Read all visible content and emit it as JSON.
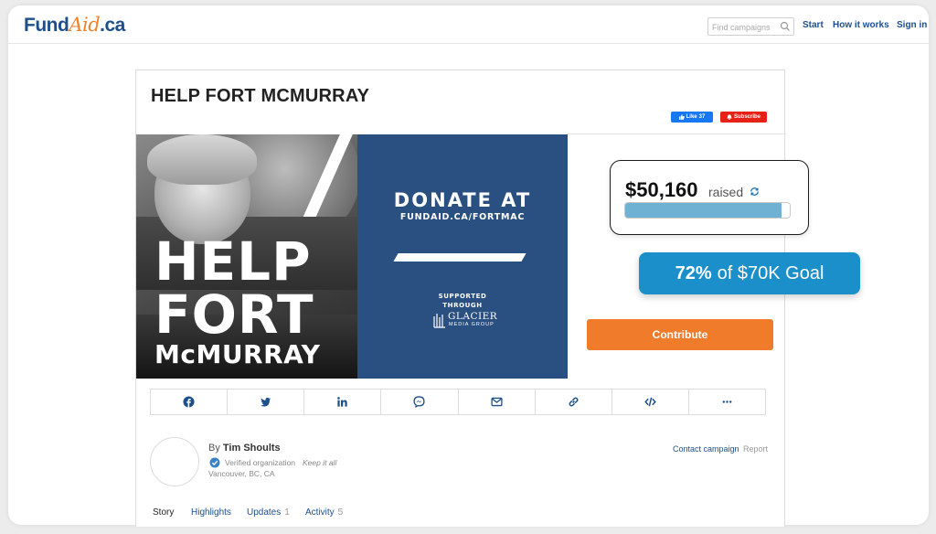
{
  "header": {
    "logo_part1": "Fund",
    "logo_part2": "Aid",
    "logo_part3": ".ca",
    "search_placeholder": "Find campaigns",
    "nav": [
      "Start",
      "How it works",
      "Sign in"
    ]
  },
  "campaign": {
    "title": "HELP FORT MCMURRAY",
    "fb_like_label": "Like",
    "fb_like_count": "37",
    "subscribe_label": "Subscribe",
    "hero": {
      "help": "HELP",
      "fort": "FORT",
      "mcmurray": "McMURRAY",
      "donate_at": "DONATE AT",
      "donate_url": "FUNDAID.CA/FORTMAC",
      "supported_line1": "SUPPORTED",
      "supported_line2": "THROUGH",
      "sponsor_name": "GLACIER",
      "sponsor_sub": "MEDIA GROUP"
    },
    "raised_amount": "$50,160",
    "raised_label": "raised",
    "progress_fraction": 0.95,
    "goal_percent": "72%",
    "goal_text": "of $70K Goal",
    "contribute_label": "Contribute",
    "share_icons": [
      "facebook-icon",
      "twitter-icon",
      "linkedin-icon",
      "messenger-icon",
      "email-icon",
      "link-icon",
      "embed-icon",
      "more-icon"
    ],
    "organizer": {
      "by_prefix": "By",
      "name": "Tim Shoults",
      "verified": "Verified organization",
      "keep": "Keep it all",
      "location": "Vancouver, BC, CA"
    },
    "contact_label": "Contact campaign",
    "report_label": "Report",
    "tabs": [
      {
        "label": "Story",
        "count": ""
      },
      {
        "label": "Highlights",
        "count": ""
      },
      {
        "label": "Updates",
        "count": "1"
      },
      {
        "label": "Activity",
        "count": "5"
      }
    ]
  },
  "colors": {
    "brand_blue": "#1d4f8c",
    "brand_orange": "#f07b2a",
    "progress_fill": "#6fb1d3",
    "goal_badge": "#1a8fca",
    "hero_blue": "#2a5082"
  }
}
